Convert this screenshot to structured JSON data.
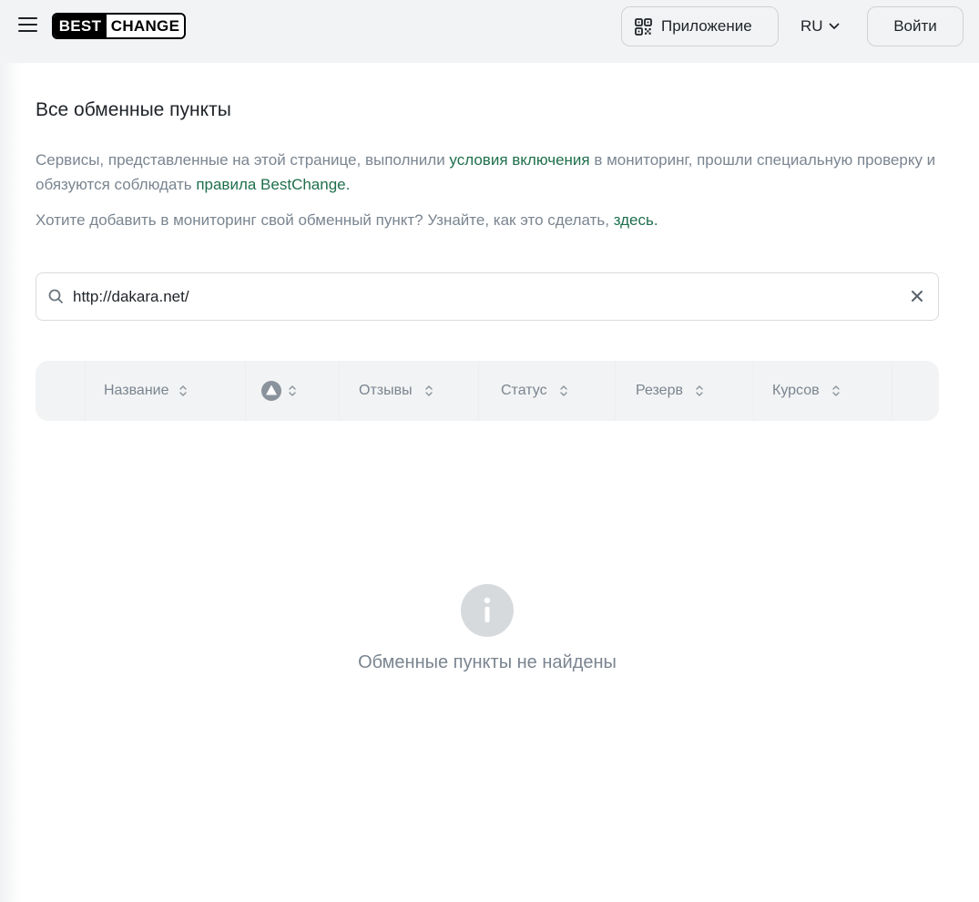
{
  "header": {
    "logo_left": "BEST",
    "logo_right": "CHANGE",
    "app_button": "Приложение",
    "lang": "RU",
    "login": "Войти"
  },
  "page": {
    "title": "Все обменные пункты",
    "desc": {
      "part1": "Сервисы, представленные на этой странице, выполнили ",
      "link1": "условия включения",
      "part2": " в мониторинг, прошли специальную проверку и обязуются соблюдать ",
      "link2": "правила BestChange",
      "part3": "."
    },
    "desc2": {
      "part1": "Хотите добавить в мониторинг свой обменный пункт? Узнайте, как это сделать, ",
      "link": "здесь",
      "part2": "."
    }
  },
  "search": {
    "value": "http://dakara.net/"
  },
  "table": {
    "columns": [
      "Название",
      "",
      "Отзывы",
      "Статус",
      "Резерв",
      "Курсов"
    ]
  },
  "empty_state": {
    "text": "Обменные пункты не найдены"
  },
  "colors": {
    "link": "#1e6f4d",
    "muted_text": "#7a8590",
    "header_bg": "#f2f3f4"
  }
}
